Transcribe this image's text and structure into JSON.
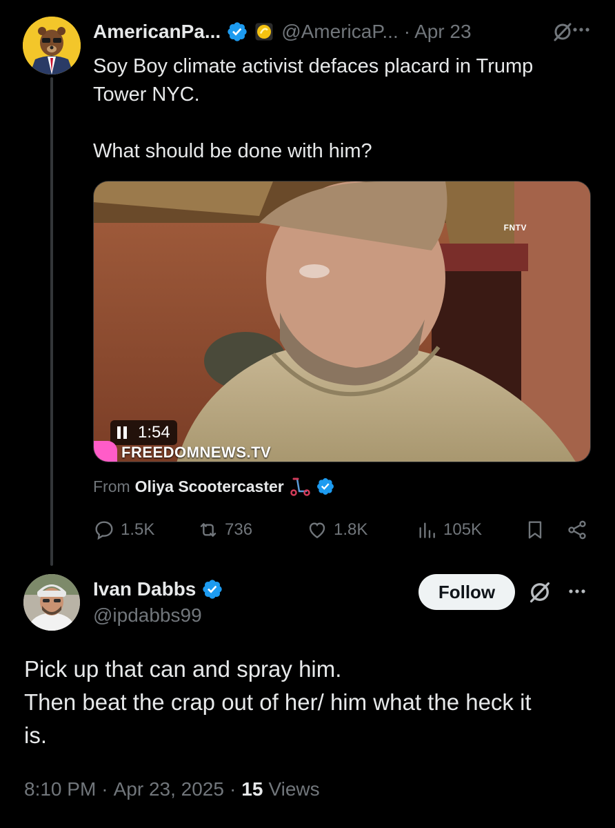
{
  "parent_tweet": {
    "author_name": "AmericanPa...",
    "handle": "@AmericaP...",
    "separator": "·",
    "date": "Apr 23",
    "text": "Soy Boy climate activist defaces placard in Trump\nTower NYC.\n\nWhat should be done with him?",
    "video": {
      "elapsed": "1:54",
      "watermark": "FREEDOMNEWS.TV",
      "corner_logo": "FNTV"
    },
    "from_label": "From",
    "source_name": "Oliya Scootercaster",
    "stats": {
      "replies": "1.5K",
      "reposts": "736",
      "likes": "1.8K",
      "views": "105K"
    }
  },
  "reply": {
    "author_name": "Ivan Dabbs",
    "handle": "@ipdabbs99",
    "follow_label": "Follow",
    "text": "Pick up that can and spray him.\nThen beat the crap out of her/ him what the heck it\nis.",
    "time": "8:10 PM",
    "separator": "·",
    "date": "Apr 23, 2025",
    "views_count": "15",
    "views_label": "Views"
  },
  "colors": {
    "background": "#000000",
    "text": "#e7e9ea",
    "muted": "#71767b",
    "verified": "#1d9bf0",
    "follow_button": "#eff3f4"
  }
}
